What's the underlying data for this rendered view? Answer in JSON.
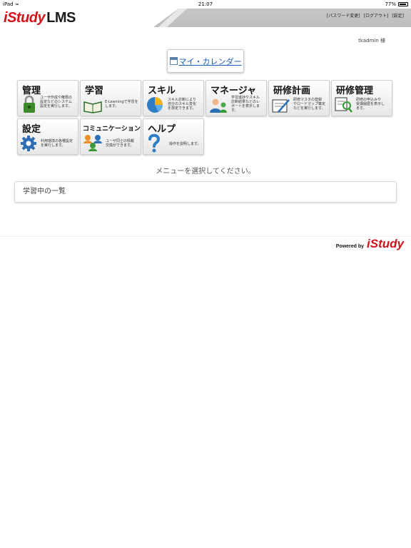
{
  "status_bar": {
    "device": "iPad",
    "time": "21:07",
    "battery": "77%"
  },
  "header": {
    "logo_i": "i",
    "logo_study": "Study",
    "logo_lms": "LMS",
    "links": [
      "[パスワード変更]",
      "[ログアウト]",
      "[設定]"
    ]
  },
  "user": {
    "name": "tkadmin 様"
  },
  "calendar": {
    "label": "マイ・カレンダー"
  },
  "menu": {
    "tiles": [
      {
        "title": "管理",
        "desc": [
          "ユーザ作成や権限の",
          "設定などのシステム",
          "設定を実行します。"
        ],
        "icon": "lock-icon"
      },
      {
        "title": "学習",
        "desc": [
          "E-Learningで学習を",
          "します。"
        ],
        "icon": "book-icon"
      },
      {
        "title": "スキル",
        "desc": [
          "スキル診断により",
          "自分のスキル変化",
          "を測定できます。"
        ],
        "icon": "pie-chart-icon"
      },
      {
        "title": "マネージャ",
        "desc": [
          "学習進捗やスキル",
          "診断結果などのレ",
          "ポートを表示しま",
          "す。"
        ],
        "icon": "manager-icon"
      },
      {
        "title": "研修計画",
        "desc": [
          "研修マスタの登録",
          "やロードマップ策定",
          "などを実行します。"
        ],
        "icon": "plan-icon"
      },
      {
        "title": "研修管理",
        "desc": [
          "研修の申込みや",
          "受講履歴を表示し",
          "ます。"
        ],
        "icon": "training-icon"
      },
      {
        "title": "設定",
        "desc": [
          "利用環境の各種設定",
          "を実行します。"
        ],
        "icon": "gear-icon"
      },
      {
        "title": "コミュニケーション",
        "desc": [
          "ユーザ同士の情報",
          "交換ができます。"
        ],
        "icon": "people-icon"
      },
      {
        "title": "ヘルプ",
        "desc": [
          "操作を説明します。"
        ],
        "icon": "question-icon"
      }
    ]
  },
  "message": "メニューを選択してください。",
  "panel": {
    "title": "学習中の一覧"
  },
  "footer": {
    "powered_by": "Powered by",
    "brand": "iStudy"
  },
  "colors": {
    "brand_red": "#d3121a",
    "link_blue": "#1a5bb8",
    "header_gray": "#c4c4c4"
  }
}
